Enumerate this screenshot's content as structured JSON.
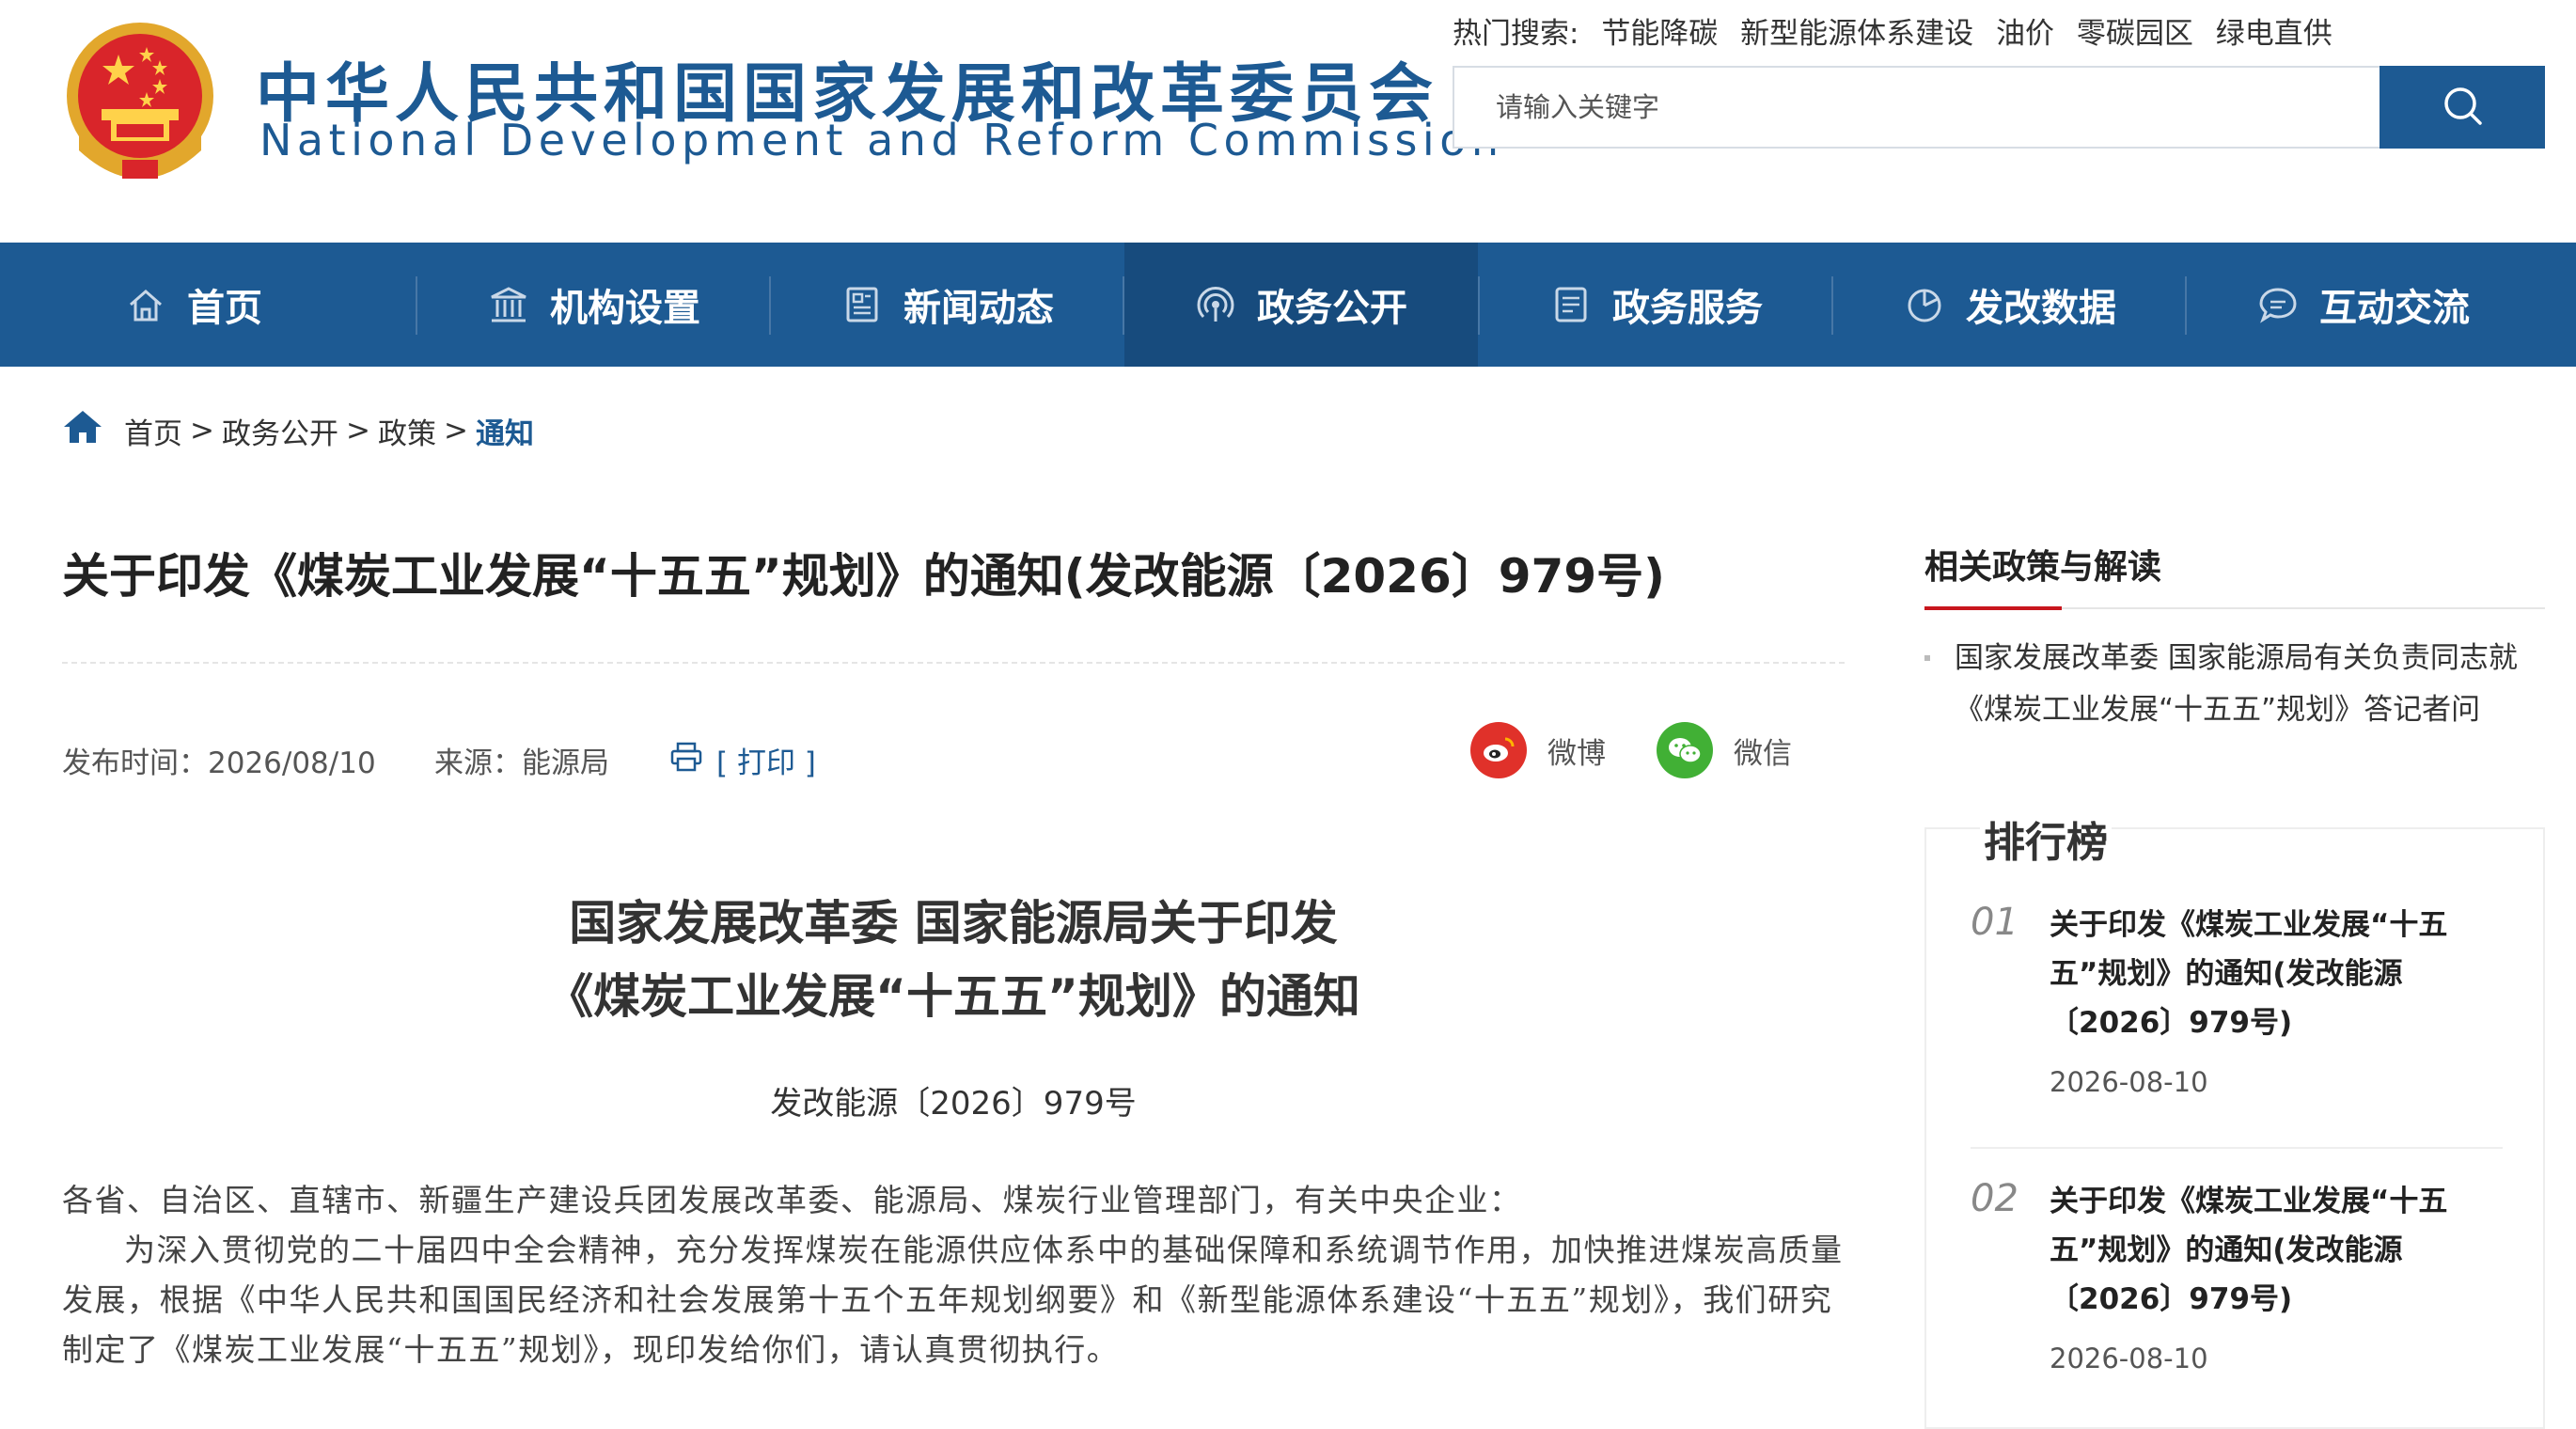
{
  "header": {
    "site_name_cn": "中华人民共和国国家发展和改革委员会",
    "site_name_en": "National Development and Reform Commission",
    "hot_search_label": "热门搜索:",
    "hot_keywords": [
      "节能降碳",
      "新型能源体系建设",
      "油价",
      "零碳园区",
      "绿电直供"
    ],
    "search_placeholder": "请输入关键字"
  },
  "nav": {
    "items": [
      {
        "label": "首页",
        "icon": "home-icon"
      },
      {
        "label": "机构设置",
        "icon": "building-icon"
      },
      {
        "label": "新闻动态",
        "icon": "news-icon"
      },
      {
        "label": "政务公开",
        "icon": "broadcast-icon",
        "active": true
      },
      {
        "label": "政务服务",
        "icon": "document-icon"
      },
      {
        "label": "发改数据",
        "icon": "pie-chart-icon"
      },
      {
        "label": "互动交流",
        "icon": "chat-icon"
      }
    ]
  },
  "breadcrumb": {
    "items": [
      "首页",
      "政务公开",
      "政策"
    ],
    "separator": ">",
    "current": "通知"
  },
  "article": {
    "title": "关于印发《煤炭工业发展“十五五”规划》的通知(发改能源〔2026〕979号)",
    "publish_time": "发布时间：2026/08/10",
    "source": "来源：能源局",
    "print_label": "[ 打印 ]",
    "share_weibo": "微博",
    "share_wechat": "微信",
    "doc_heading_line1": "国家发展改革委 国家能源局关于印发",
    "doc_heading_line2": "《煤炭工业发展“十五五”规划》的通知",
    "doc_number": "发改能源〔2026〕979号",
    "addressee": "各省、自治区、直辖市、新疆生产建设兵团发展改革委、能源局、煤炭行业管理部门，有关中央企业：",
    "paragraph1": "为深入贯彻党的二十届四中全会精神，充分发挥煤炭在能源供应体系中的基础保障和系统调节作用，加快推进煤炭高质量发展，根据《中华人民共和国国民经济和社会发展第十五个五年规划纲要》和《新型能源体系建设“十五五”规划》，我们研究制定了《煤炭工业发展“十五五”规划》，现印发给你们，请认真贯彻执行。"
  },
  "sidebar": {
    "related_title": "相关政策与解读",
    "related_items": [
      "国家发展改革委 国家能源局有关负责同志就《煤炭工业发展“十五五”规划》答记者问"
    ],
    "ranking_title": "排行榜",
    "ranking": [
      {
        "no": "01",
        "title": "关于印发《煤炭工业发展“十五五”规划》的通知(发改能源〔2026〕979号)",
        "date": "2026-08-10"
      },
      {
        "no": "02",
        "title": "关于印发《煤炭工业发展“十五五”规划》的通知(发改能源〔2026〕979号)",
        "date": "2026-08-10"
      }
    ]
  },
  "colors": {
    "brand_blue": "#1d5a93",
    "nav_active": "#174b7d",
    "accent_red": "#c8161d",
    "weibo_red": "#e0312a",
    "wechat_green": "#41b035"
  }
}
